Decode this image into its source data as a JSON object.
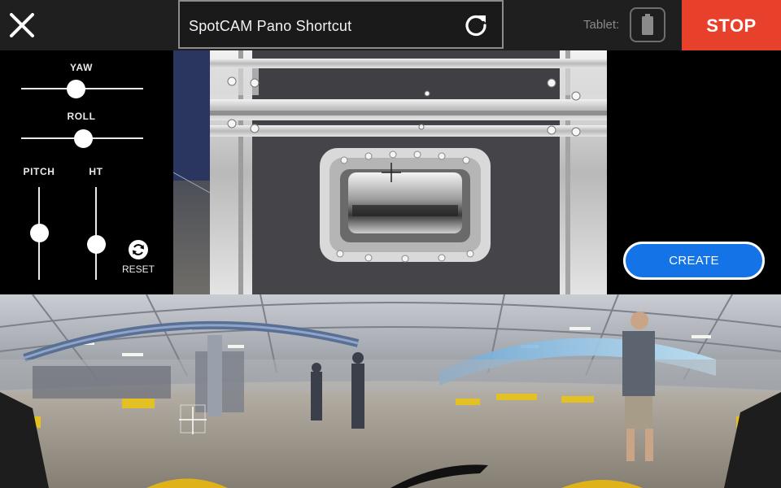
{
  "header": {
    "title": "SpotCAM Pano Shortcut",
    "tablet_label": "Tablet:",
    "stop_label": "STOP",
    "icons": {
      "close": "close-icon",
      "refresh": "refresh-icon",
      "battery": "battery-icon"
    }
  },
  "controls": {
    "yaw_label": "YAW",
    "roll_label": "ROLL",
    "pitch_label": "PITCH",
    "height_label": "HT",
    "reset_label": "RESET"
  },
  "actions": {
    "create_label": "CREATE"
  },
  "colors": {
    "stop": "#e7412b",
    "create": "#1473e6",
    "topbar": "#1f1f1f"
  }
}
